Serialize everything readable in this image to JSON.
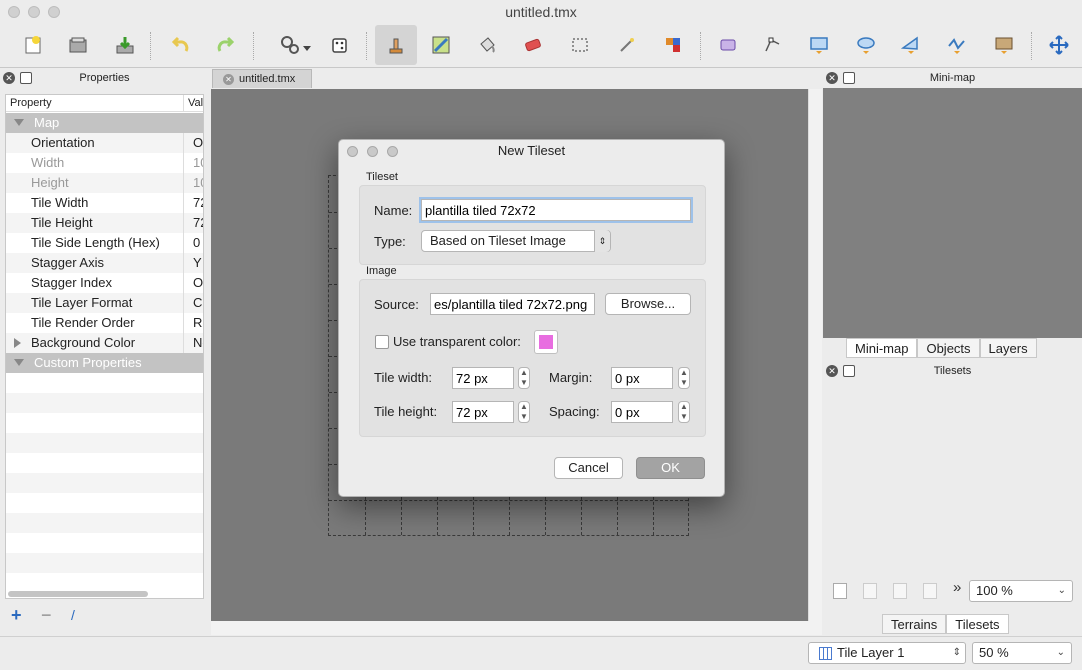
{
  "window": {
    "title": "untitled.tmx"
  },
  "toolbar": {
    "icons": [
      "new-map-icon",
      "open-icon",
      "save-icon",
      "undo-icon",
      "redo-icon",
      "command-icon",
      "random-mode-icon",
      "stamp-brush-icon",
      "terrain-brush-icon",
      "bucket-fill-icon",
      "eraser-icon",
      "rectangle-select-icon",
      "magic-wand-icon",
      "select-same-tile-icon",
      "select-objects-icon",
      "edit-polygons-icon",
      "insert-rectangle-icon",
      "insert-ellipse-icon",
      "insert-polygon-icon",
      "insert-polyline-icon",
      "insert-tile-icon",
      "move-icon"
    ]
  },
  "properties_panel": {
    "title": "Properties",
    "columns": {
      "property": "Property",
      "value": "Val"
    },
    "groups": {
      "map": "Map",
      "custom": "Custom Properties"
    },
    "rows": [
      {
        "key": "Orientation",
        "value": "Or",
        "muted": false
      },
      {
        "key": "Width",
        "value": "10",
        "muted": true
      },
      {
        "key": "Height",
        "value": "10",
        "muted": true
      },
      {
        "key": "Tile Width",
        "value": "72",
        "muted": false
      },
      {
        "key": "Tile Height",
        "value": "72",
        "muted": false
      },
      {
        "key": "Tile Side Length (Hex)",
        "value": "0",
        "muted": false
      },
      {
        "key": "Stagger Axis",
        "value": "Y",
        "muted": false
      },
      {
        "key": "Stagger Index",
        "value": "Od",
        "muted": false
      },
      {
        "key": "Tile Layer Format",
        "value": "CS",
        "muted": false
      },
      {
        "key": "Tile Render Order",
        "value": "Rig",
        "muted": false
      },
      {
        "key": "Background Color",
        "value": "No",
        "muted": false
      }
    ]
  },
  "document_tab": {
    "label": "untitled.tmx"
  },
  "minimap_panel": {
    "title": "Mini-map",
    "tabs": [
      "Mini-map",
      "Objects",
      "Layers"
    ]
  },
  "tilesets_panel": {
    "title": "Tilesets",
    "zoom": "100 %",
    "tabs": [
      "Terrains",
      "Tilesets"
    ]
  },
  "dialog": {
    "title": "New Tileset",
    "tileset_group": "Tileset",
    "name_label": "Name:",
    "name_value": "plantilla tiled 72x72",
    "type_label": "Type:",
    "type_value": "Based on Tileset Image",
    "image_group": "Image",
    "source_label": "Source:",
    "source_value": "es/plantilla tiled 72x72.png",
    "browse_label": "Browse...",
    "transparent_label": "Use transparent color:",
    "transparent_color": "#e86de0",
    "tile_width_label": "Tile width:",
    "tile_width_value": "72 px",
    "tile_height_label": "Tile height:",
    "tile_height_value": "72 px",
    "margin_label": "Margin:",
    "margin_value": "0 px",
    "spacing_label": "Spacing:",
    "spacing_value": "0 px",
    "cancel_label": "Cancel",
    "ok_label": "OK"
  },
  "statusbar": {
    "layer": "Tile Layer 1",
    "zoom": "50 %"
  }
}
